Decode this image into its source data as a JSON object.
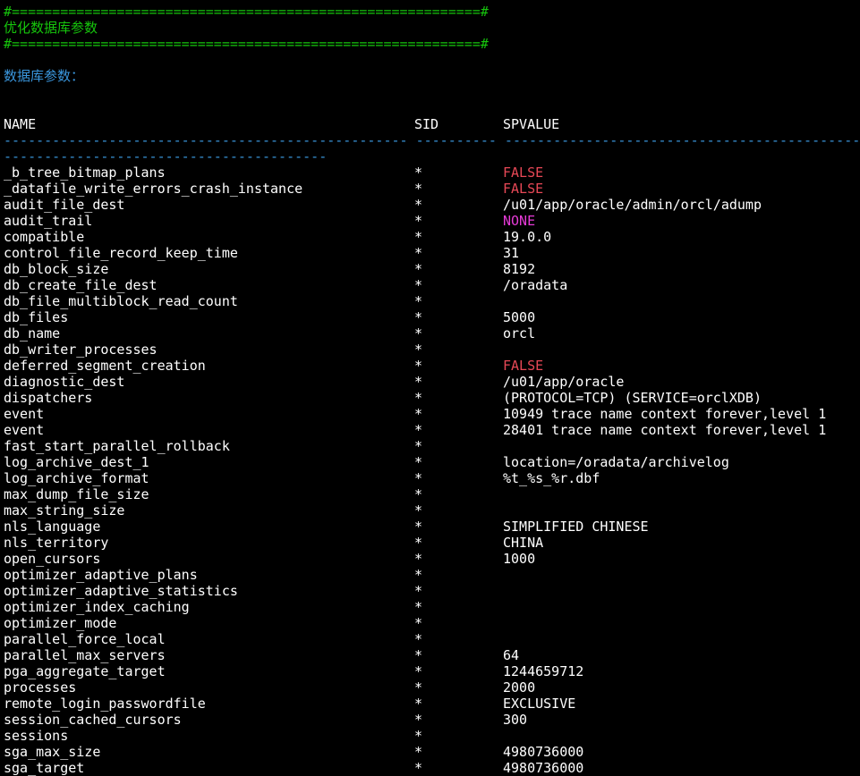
{
  "header": {
    "border_top": "#==========================================================#",
    "title": "优化数据库参数",
    "border_bottom": "#==========================================================#",
    "section_label": "数据库参数："
  },
  "table": {
    "columns": [
      "NAME",
      "SID",
      "SPVALUE"
    ],
    "dash_line_1": "-------------------------------------------------- ---------- -----------------------------------------------------------------------",
    "dash_line_2": "----------------------------------------",
    "rows": [
      {
        "name": "_b_tree_bitmap_plans",
        "sid": "*",
        "value": "FALSE",
        "color": "red"
      },
      {
        "name": "_datafile_write_errors_crash_instance",
        "sid": "*",
        "value": "FALSE",
        "color": "red"
      },
      {
        "name": "audit_file_dest",
        "sid": "*",
        "value": "/u01/app/oracle/admin/orcl/adump",
        "color": "white"
      },
      {
        "name": "audit_trail",
        "sid": "*",
        "value": "NONE",
        "color": "mag"
      },
      {
        "name": "compatible",
        "sid": "*",
        "value": "19.0.0",
        "color": "white"
      },
      {
        "name": "control_file_record_keep_time",
        "sid": "*",
        "value": "31",
        "color": "white"
      },
      {
        "name": "db_block_size",
        "sid": "*",
        "value": "8192",
        "color": "white"
      },
      {
        "name": "db_create_file_dest",
        "sid": "*",
        "value": "/oradata",
        "color": "white"
      },
      {
        "name": "db_file_multiblock_read_count",
        "sid": "*",
        "value": "",
        "color": "white"
      },
      {
        "name": "db_files",
        "sid": "*",
        "value": "5000",
        "color": "white"
      },
      {
        "name": "db_name",
        "sid": "*",
        "value": "orcl",
        "color": "white"
      },
      {
        "name": "db_writer_processes",
        "sid": "*",
        "value": "",
        "color": "white"
      },
      {
        "name": "deferred_segment_creation",
        "sid": "*",
        "value": "FALSE",
        "color": "red"
      },
      {
        "name": "diagnostic_dest",
        "sid": "*",
        "value": "/u01/app/oracle",
        "color": "white"
      },
      {
        "name": "dispatchers",
        "sid": "*",
        "value": "(PROTOCOL=TCP) (SERVICE=orclXDB)",
        "color": "white"
      },
      {
        "name": "event",
        "sid": "*",
        "value": "10949 trace name context forever,level 1",
        "color": "white"
      },
      {
        "name": "event",
        "sid": "*",
        "value": "28401 trace name context forever,level 1",
        "color": "white"
      },
      {
        "name": "fast_start_parallel_rollback",
        "sid": "*",
        "value": "",
        "color": "white"
      },
      {
        "name": "log_archive_dest_1",
        "sid": "*",
        "value": "location=/oradata/archivelog",
        "color": "white"
      },
      {
        "name": "log_archive_format",
        "sid": "*",
        "value": "%t_%s_%r.dbf",
        "color": "white"
      },
      {
        "name": "max_dump_file_size",
        "sid": "*",
        "value": "",
        "color": "white"
      },
      {
        "name": "max_string_size",
        "sid": "*",
        "value": "",
        "color": "white"
      },
      {
        "name": "nls_language",
        "sid": "*",
        "value": "SIMPLIFIED CHINESE",
        "color": "white"
      },
      {
        "name": "nls_territory",
        "sid": "*",
        "value": "CHINA",
        "color": "white"
      },
      {
        "name": "open_cursors",
        "sid": "*",
        "value": "1000",
        "color": "white"
      },
      {
        "name": "optimizer_adaptive_plans",
        "sid": "*",
        "value": "",
        "color": "white"
      },
      {
        "name": "optimizer_adaptive_statistics",
        "sid": "*",
        "value": "",
        "color": "white"
      },
      {
        "name": "optimizer_index_caching",
        "sid": "*",
        "value": "",
        "color": "white"
      },
      {
        "name": "optimizer_mode",
        "sid": "*",
        "value": "",
        "color": "white"
      },
      {
        "name": "parallel_force_local",
        "sid": "*",
        "value": "",
        "color": "white"
      },
      {
        "name": "parallel_max_servers",
        "sid": "*",
        "value": "64",
        "color": "white"
      },
      {
        "name": "pga_aggregate_target",
        "sid": "*",
        "value": "1244659712",
        "color": "white"
      },
      {
        "name": "processes",
        "sid": "*",
        "value": "2000",
        "color": "white"
      },
      {
        "name": "remote_login_passwordfile",
        "sid": "*",
        "value": "EXCLUSIVE",
        "color": "white"
      },
      {
        "name": "session_cached_cursors",
        "sid": "*",
        "value": "300",
        "color": "white"
      },
      {
        "name": "sessions",
        "sid": "*",
        "value": "",
        "color": "white"
      },
      {
        "name": "sga_max_size",
        "sid": "*",
        "value": "4980736000",
        "color": "white"
      },
      {
        "name": "sga_target",
        "sid": "*",
        "value": "4980736000",
        "color": "white"
      }
    ]
  }
}
